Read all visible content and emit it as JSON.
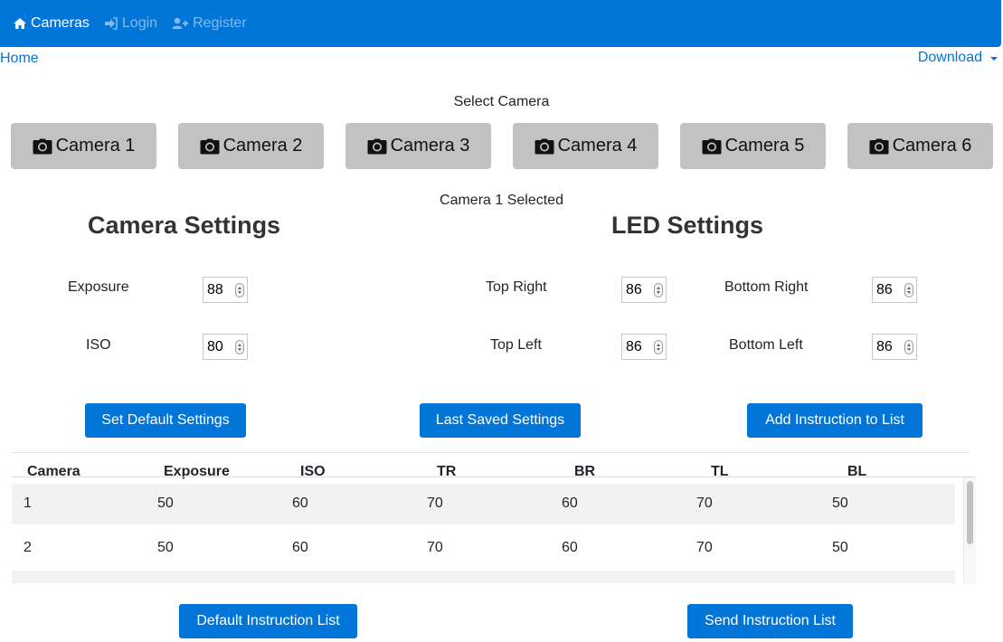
{
  "nav": {
    "items": [
      {
        "label": "Cameras",
        "icon": "home-icon",
        "active": true
      },
      {
        "label": "Login",
        "icon": "sign-in-icon",
        "active": false
      },
      {
        "label": "Register",
        "icon": "user-plus-icon",
        "active": false
      }
    ]
  },
  "breadcrumb": {
    "home": "Home"
  },
  "download": {
    "label": "Download"
  },
  "camera_select": {
    "title": "Select Camera",
    "buttons": [
      "Camera 1",
      "Camera 2",
      "Camera 3",
      "Camera 4",
      "Camera 5",
      "Camera 6"
    ],
    "status": "Camera 1 Selected"
  },
  "camera_settings": {
    "title": "Camera Settings",
    "exposure_label": "Exposure",
    "exposure_value": "88",
    "iso_label": "ISO",
    "iso_value": "80"
  },
  "led_settings": {
    "title": "LED Settings",
    "top_right_label": "Top Right",
    "top_right_value": "86",
    "bottom_right_label": "Bottom Right",
    "bottom_right_value": "86",
    "top_left_label": "Top Left",
    "top_left_value": "86",
    "bottom_left_label": "Bottom Left",
    "bottom_left_value": "86"
  },
  "actions": {
    "set_default": "Set Default Settings",
    "last_saved": "Last Saved Settings",
    "add_instruction": "Add Instruction to List",
    "default_list": "Default Instruction List",
    "send_list": "Send Instruction List"
  },
  "table": {
    "columns": [
      "Camera",
      "Exposure",
      "ISO",
      "TR",
      "BR",
      "TL",
      "BL"
    ],
    "rows": [
      [
        "1",
        "50",
        "60",
        "70",
        "60",
        "70",
        "50"
      ],
      [
        "2",
        "50",
        "60",
        "70",
        "60",
        "70",
        "50"
      ]
    ]
  },
  "colors": {
    "primary": "#0275d8",
    "camera_button": "#c2c2c2"
  }
}
